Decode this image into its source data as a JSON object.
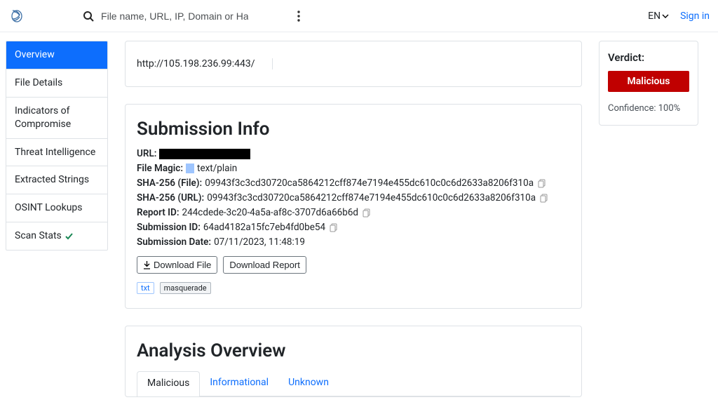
{
  "topbar": {
    "search_placeholder": "File name, URL, IP, Domain or Hash",
    "lang": "EN",
    "signin": "Sign in"
  },
  "sidebar": {
    "items": [
      {
        "label": "Overview",
        "active": true
      },
      {
        "label": "File Details"
      },
      {
        "label": "Indicators of Compromise"
      },
      {
        "label": "Threat Intelligence"
      },
      {
        "label": "Extracted Strings"
      },
      {
        "label": "OSINT Lookups"
      },
      {
        "label": "Scan Stats",
        "check": true
      }
    ]
  },
  "url_card": {
    "url": "http://105.198.236.99:443/"
  },
  "submission": {
    "heading": "Submission Info",
    "url_label": "URL:",
    "filemagic_label": "File Magic:",
    "filemagic_value": "text/plain",
    "sha_file_label": "SHA-256 (File):",
    "sha_file_value": "09943f3c3cd30720ca5864212cff874e7194e455dc610c0c6d2633a8206f310a",
    "sha_url_label": "SHA-256 (URL):",
    "sha_url_value": "09943f3c3cd30720ca5864212cff874e7194e455dc610c0c6d2633a8206f310a",
    "report_id_label": "Report ID:",
    "report_id_value": "244cdede-3c20-4a5a-af8c-3707d6a66b6d",
    "submission_id_label": "Submission ID:",
    "submission_id_value": "64ad4182a15fc7eb4fd0be54",
    "date_label": "Submission Date:",
    "date_value": "07/11/2023, 11:48:19",
    "download_file": "Download File",
    "download_report": "Download Report",
    "tag_txt": "txt",
    "tag_masq": "masquerade"
  },
  "analysis": {
    "heading": "Analysis Overview",
    "tabs": {
      "malicious": "Malicious",
      "informational": "Informational",
      "unknown": "Unknown"
    }
  },
  "verdict": {
    "title": "Verdict:",
    "value": "Malicious",
    "confidence_label": "Confidence:",
    "confidence_value": "100%"
  }
}
